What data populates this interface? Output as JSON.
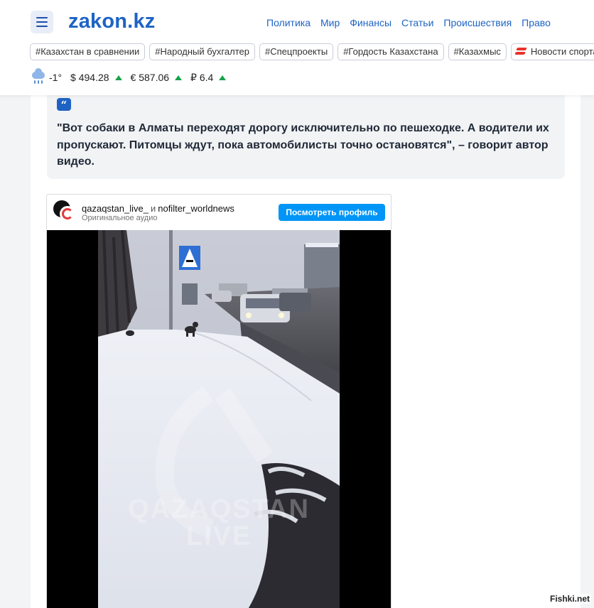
{
  "header": {
    "logo": "zakon.kz",
    "nav": [
      "Политика",
      "Мир",
      "Финансы",
      "Статьи",
      "Происшествия",
      "Право"
    ],
    "tags": [
      "#Казахстан в сравнении",
      "#Народный бухгалтер",
      "#Спецпроекты",
      "#Гордость Казахстана",
      "#Казахмыс",
      "Новости спорта"
    ],
    "ticker": {
      "temperature": "-1°",
      "usd": "$ 494.28",
      "eur": "€ 587.06",
      "rub": "₽ 6.4",
      "trend_color": "#16a34a"
    },
    "accent_color": "#1e63c4"
  },
  "article": {
    "quote_icon": "quote-icon",
    "quote": "\"Вот собаки в Алматы переходят дорогу исключительно по пешеходке. А водители их пропускают. Питомцы ждут, пока автомобилисты точно остановятся\", – говорит автор видео."
  },
  "embed": {
    "author1": "qazaqstan_live_",
    "and": "и",
    "author2": "nofilter_worldnews",
    "subtitle": "Оригинальное аудио",
    "profile_button": "Посмотреть профиль",
    "watermark_line1": "QAZAQSTAN",
    "watermark_line2": "LIVE",
    "button_color": "#0095f6"
  },
  "source_watermark": "Fishki.net"
}
